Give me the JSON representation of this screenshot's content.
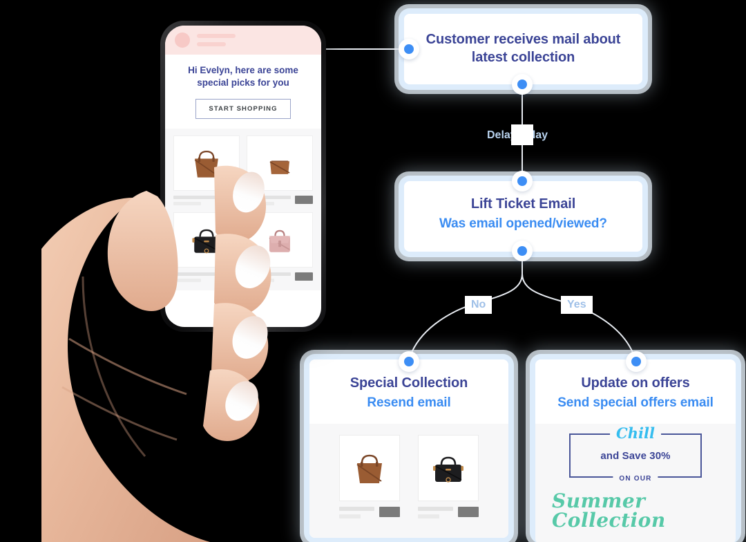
{
  "colors": {
    "navy": "#3b4496",
    "blue": "#3a8cf2",
    "dot": "#3d8ef5",
    "halo": "#deeefd",
    "line": "#e8ecf2",
    "edge_label": "#9fc0e8",
    "promo_border": "#4a5699",
    "promo_chill": "#35bdef",
    "promo_summer": "#57c9a8",
    "mail_header_pink": "#fbe5e3",
    "background": "#000000"
  },
  "flow": {
    "nodes": [
      {
        "id": "node-customer-receives-mail",
        "title": "Customer receives mail about latest collection",
        "subtitle": ""
      },
      {
        "id": "node-lift-ticket-email",
        "title": "Lift Ticket Email",
        "subtitle": "Was email opened/viewed?"
      },
      {
        "id": "node-special-collection",
        "title": "Special Collection",
        "subtitle": "Resend email"
      },
      {
        "id": "node-update-on-offers",
        "title": "Update on offers",
        "subtitle": "Send special offers email"
      }
    ],
    "edge_labels": {
      "delay": "Delay 1 day",
      "branch_no": "No",
      "branch_yes": "Yes"
    }
  },
  "phone": {
    "mail": {
      "greeting": "Hi Evelyn, here are some special picks for you",
      "cta_label": "START SHOPPING",
      "products": [
        {
          "name": "brown-tote-bag",
          "color": "#9a5c33"
        },
        {
          "name": "brown-crossbody-bag",
          "color": "#a5653a"
        },
        {
          "name": "black-satchel-bag",
          "color": "#1d1d1f"
        },
        {
          "name": "pink-handbag",
          "color": "#ddaeae"
        }
      ]
    }
  },
  "resend_card": {
    "products": [
      {
        "name": "brown-tote-bag",
        "color": "#9a5c33"
      },
      {
        "name": "black-satchel-bag",
        "color": "#1d1d1f"
      }
    ]
  },
  "offers_card": {
    "promo": {
      "headline": "Chill",
      "save_text": "and Save 30%",
      "on_our": "ON OUR",
      "collection": "Summer Collection"
    }
  }
}
